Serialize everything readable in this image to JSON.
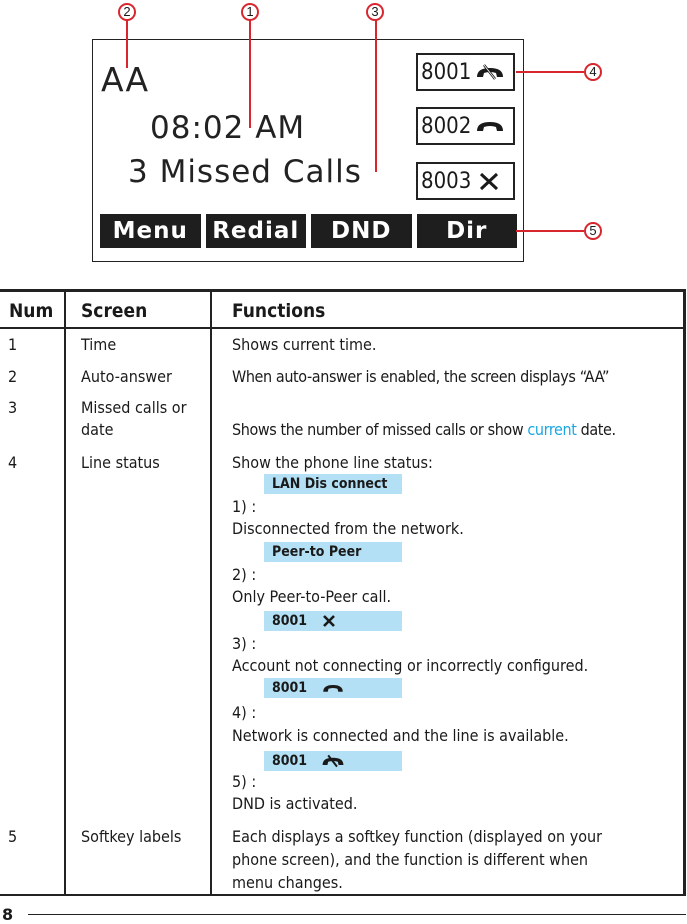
{
  "diagram": {
    "screen": {
      "auto_answer": "AA",
      "time": "08:02 AM",
      "missed_calls": "3 Missed Calls"
    },
    "lines": [
      {
        "number": "8001",
        "icon": "dnd-phone-icon"
      },
      {
        "number": "8002",
        "icon": "handset-icon"
      },
      {
        "number": "8003",
        "icon": "x-icon"
      }
    ],
    "softkeys": [
      "Menu",
      "Redial",
      "DND",
      "Dir"
    ],
    "callouts": [
      "1",
      "2",
      "3",
      "4",
      "5"
    ],
    "callout_color": "#d8262f"
  },
  "table": {
    "headers": {
      "num": "Num",
      "screen": "Screen",
      "functions": "Functions"
    },
    "rows": [
      {
        "num": "1",
        "screen": "Time",
        "function": "Shows current time."
      },
      {
        "num": "2",
        "screen": "Auto-answer",
        "function": "When auto-answer is enabled, the screen displays “AA”"
      },
      {
        "num": "3",
        "screen_line1": "Missed calls or",
        "screen_line2": "date",
        "function_pre": "Shows the number of missed calls or show ",
        "function_accent": "current",
        "function_post": " date."
      },
      {
        "num": "4",
        "screen": "Line status",
        "function_intro": "Show the phone line status:",
        "statuses": [
          {
            "chip_text": "LAN Dis connect",
            "chip_icon": "",
            "label": "1) :",
            "description": "Disconnected from the network."
          },
          {
            "chip_text": "Peer-to Peer",
            "chip_icon": "",
            "label": "2) :",
            "description": "Only Peer-to-Peer call."
          },
          {
            "chip_text": "8001",
            "chip_icon": "x-icon",
            "label": "3) :",
            "description": "Account not connecting or incorrectly configured."
          },
          {
            "chip_text": "8001",
            "chip_icon": "handset-icon",
            "label": "4) :",
            "description": "Network is connected and the line is available."
          },
          {
            "chip_text": "8001",
            "chip_icon": "dnd-phone-icon",
            "label": "5) :",
            "description": "DND is activated."
          }
        ]
      },
      {
        "num": "5",
        "screen": "Softkey labels",
        "function_lines": [
          "Each displays a softkey function (displayed on your",
          "phone screen), and the function is different when",
          "menu changes."
        ]
      }
    ],
    "accent_color": "#1ba7e0",
    "chip_color": "#b3e0f5"
  },
  "page_number": "8"
}
